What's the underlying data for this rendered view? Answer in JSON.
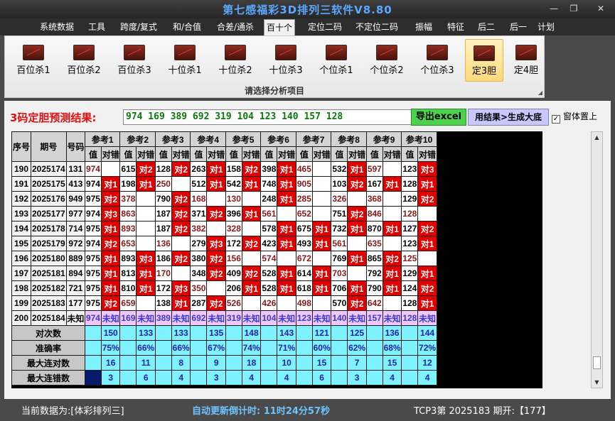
{
  "app": {
    "title": "第七感福彩3D排列三软件V8.80",
    "controls": {
      "minimize": "—",
      "restore": "❐",
      "close": "✕"
    }
  },
  "menu": [
    "系统数据",
    "工具",
    "跨度/复式",
    "和/合值",
    "合差/通杀",
    "百十个",
    "定位二码",
    "不定位二码",
    "振幅",
    "特征",
    "后二",
    "后一",
    "计划"
  ],
  "menu_active": "百十个",
  "ribbon": {
    "buttons": [
      "百位杀1",
      "百位杀2",
      "百位杀3",
      "十位杀1",
      "十位杀2",
      "十位杀3",
      "个位杀1",
      "个位杀2",
      "个位杀3",
      "定3胆",
      "定4胆"
    ],
    "active": "定3胆",
    "icon": "chart-icon",
    "caption": "请选择分析项目"
  },
  "prediction": {
    "label": "3码定胆预测结果:",
    "value": "974 169 389 692 319 104 123 140 157 128"
  },
  "buttons": {
    "export": "导出excel",
    "generate": "用结果>生成大底"
  },
  "topmost": {
    "label": "窗体置上",
    "checked": true,
    "mark": "✓"
  },
  "table": {
    "col_headers": {
      "seq": "序号",
      "period": "期号",
      "code": "号码"
    },
    "ref_groups": [
      "参考1",
      "参考2",
      "参考3",
      "参考4",
      "参考5",
      "参考6",
      "参考7",
      "参考8",
      "参考9",
      "参考10"
    ],
    "sub_value": "值",
    "sub_result": "对错",
    "rows": [
      {
        "seq": "190",
        "period": "2025174",
        "code": "131",
        "cells": [
          [
            "974",
            ""
          ],
          [
            "615",
            "对2"
          ],
          [
            "128",
            "对2"
          ],
          [
            "263",
            "对1"
          ],
          [
            "158",
            "对2"
          ],
          [
            "398",
            "对1"
          ],
          [
            "465",
            ""
          ],
          [
            "532",
            "对1"
          ],
          [
            "597",
            ""
          ],
          [
            "123",
            "对3"
          ]
        ]
      },
      {
        "seq": "191",
        "period": "2025175",
        "code": "413",
        "cells": [
          [
            "974",
            "对1"
          ],
          [
            "198",
            "对1"
          ],
          [
            "250",
            ""
          ],
          [
            "512",
            "对1"
          ],
          [
            "542",
            "对1"
          ],
          [
            "748",
            "对1"
          ],
          [
            "905",
            ""
          ],
          [
            "103",
            "对2"
          ],
          [
            "167",
            "对1"
          ],
          [
            "128",
            "对1"
          ]
        ]
      },
      {
        "seq": "192",
        "period": "2025176",
        "code": "949",
        "cells": [
          [
            "975",
            "对2"
          ],
          [
            "378",
            ""
          ],
          [
            "790",
            "对2"
          ],
          [
            "168",
            ""
          ],
          [
            "130",
            ""
          ],
          [
            "248",
            "对1"
          ],
          [
            "285",
            ""
          ],
          [
            "326",
            ""
          ],
          [
            "368",
            ""
          ],
          [
            "129",
            "对2"
          ]
        ]
      },
      {
        "seq": "193",
        "period": "2025177",
        "code": "977",
        "cells": [
          [
            "974",
            "对3"
          ],
          [
            "863",
            ""
          ],
          [
            "187",
            "对2"
          ],
          [
            "371",
            "对2"
          ],
          [
            "396",
            "对1"
          ],
          [
            "561",
            ""
          ],
          [
            "652",
            ""
          ],
          [
            "751",
            "对2"
          ],
          [
            "846",
            ""
          ],
          [
            "128",
            ""
          ]
        ]
      },
      {
        "seq": "194",
        "period": "2025178",
        "code": "714",
        "cells": [
          [
            "975",
            "对1"
          ],
          [
            "893",
            ""
          ],
          [
            "187",
            "对2"
          ],
          [
            "382",
            ""
          ],
          [
            "328",
            ""
          ],
          [
            "578",
            "对1"
          ],
          [
            "675",
            "对1"
          ],
          [
            "732",
            "对1"
          ],
          [
            "870",
            "对1"
          ],
          [
            "127",
            "对2"
          ]
        ]
      },
      {
        "seq": "195",
        "period": "2025179",
        "code": "972",
        "cells": [
          [
            "974",
            "对2"
          ],
          [
            "653",
            ""
          ],
          [
            "136",
            ""
          ],
          [
            "279",
            "对3"
          ],
          [
            "172",
            "对2"
          ],
          [
            "423",
            "对1"
          ],
          [
            "493",
            "对1"
          ],
          [
            "561",
            ""
          ],
          [
            "635",
            ""
          ],
          [
            "123",
            "对1"
          ]
        ]
      },
      {
        "seq": "196",
        "period": "2025180",
        "code": "889",
        "cells": [
          [
            "975",
            "对1"
          ],
          [
            "893",
            "对3"
          ],
          [
            "186",
            "对2"
          ],
          [
            "380",
            "对2"
          ],
          [
            "156",
            ""
          ],
          [
            "574",
            ""
          ],
          [
            "672",
            ""
          ],
          [
            "769",
            "对1"
          ],
          [
            "865",
            "对2"
          ],
          [
            "125",
            ""
          ]
        ]
      },
      {
        "seq": "197",
        "period": "2025181",
        "code": "894",
        "cells": [
          [
            "975",
            "对1"
          ],
          [
            "813",
            "对1"
          ],
          [
            "170",
            ""
          ],
          [
            "348",
            "对2"
          ],
          [
            "409",
            "对2"
          ],
          [
            "528",
            "对1"
          ],
          [
            "614",
            "对1"
          ],
          [
            "703",
            ""
          ],
          [
            "792",
            "对1"
          ],
          [
            "129",
            "对1"
          ]
        ]
      },
      {
        "seq": "198",
        "period": "2025182",
        "code": "721",
        "cells": [
          [
            "975",
            "对1"
          ],
          [
            "810",
            "对1"
          ],
          [
            "172",
            "对3"
          ],
          [
            "350",
            ""
          ],
          [
            "206",
            "对1"
          ],
          [
            "528",
            "对1"
          ],
          [
            "618",
            "对1"
          ],
          [
            "706",
            "对1"
          ],
          [
            "790",
            "对1"
          ],
          [
            "124",
            "对2"
          ]
        ]
      },
      {
        "seq": "199",
        "period": "2025183",
        "code": "177",
        "cells": [
          [
            "975",
            "对2"
          ],
          [
            "659",
            ""
          ],
          [
            "138",
            "对1"
          ],
          [
            "287",
            "对2"
          ],
          [
            "526",
            ""
          ],
          [
            "426",
            ""
          ],
          [
            "498",
            ""
          ],
          [
            "570",
            "对2"
          ],
          [
            "642",
            ""
          ],
          [
            "128",
            "对1"
          ]
        ]
      }
    ],
    "pending_row": {
      "seq": "200",
      "period": "2025184",
      "code": "未知",
      "values": [
        "974",
        "169",
        "389",
        "692",
        "319",
        "104",
        "123",
        "140",
        "157",
        "128"
      ],
      "result": "未知"
    },
    "stats": [
      {
        "label": "对次数",
        "values": [
          "150",
          "133",
          "133",
          "135",
          "148",
          "143",
          "121",
          "125",
          "136",
          "144"
        ]
      },
      {
        "label": "准确率",
        "values": [
          "75%",
          "66%",
          "66%",
          "67%",
          "74%",
          "71%",
          "60%",
          "62%",
          "68%",
          "72%"
        ]
      },
      {
        "label": "最大连对数",
        "values": [
          "16",
          "11",
          "8",
          "9",
          "18",
          "10",
          "15",
          "7",
          "15",
          "12"
        ]
      },
      {
        "label": "最大连错数",
        "values": [
          "3",
          "6",
          "4",
          "3",
          "4",
          "4",
          "6",
          "3",
          "4",
          "4"
        ]
      }
    ]
  },
  "scrollbar": {
    "up": "▲",
    "down": "▼"
  },
  "status": {
    "left": "当前数据为:[体彩排列三]",
    "countdown": "自动更新倒计时: 11时24分57秒",
    "right": "TCP3第 2025183 期开:【177】"
  },
  "colors": {
    "hit": "#e00000",
    "stats_bg": "#7ff2ff",
    "pending_bg": "#f0c8ff",
    "prediction_text": "#0a7a0a"
  }
}
